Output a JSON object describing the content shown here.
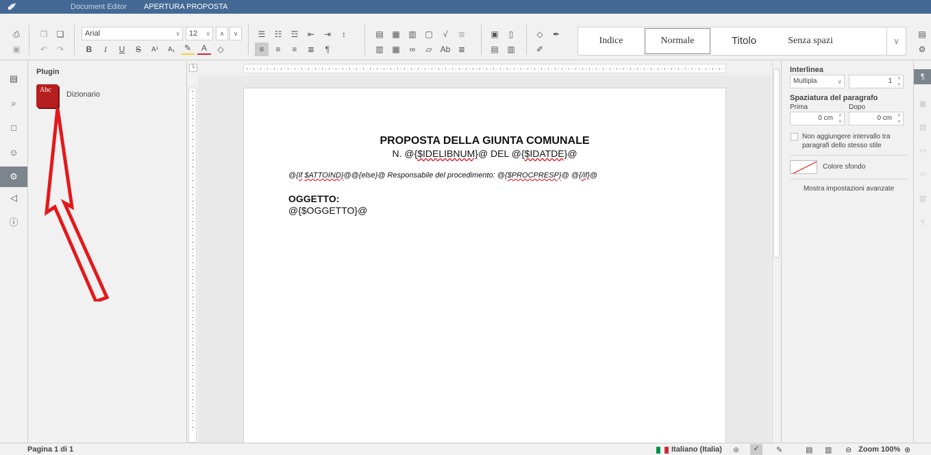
{
  "titlebar": {
    "app_name": "Document Editor",
    "document_name": "APERTURA PROPOSTA"
  },
  "toolbar": {
    "font_name": "Arial",
    "font_size": "12",
    "styles": [
      "Indice",
      "Normale",
      "Titolo",
      "Senza spazi"
    ],
    "selected_style": "Normale",
    "superscript_label": "A¹",
    "subscript_label": "A₁"
  },
  "plugin_panel": {
    "title": "Plugin",
    "plugins": [
      {
        "name": "Dizionario",
        "icon": "dictionary-book-icon",
        "icon_text": "Abc"
      }
    ]
  },
  "document": {
    "heading": "PROPOSTA DELLA GIUNTA COMUNALE",
    "subheading_prefix": "N. @{",
    "subheading_var1": "$IDELIBNUM}",
    "subheading_mid": "@ DEL @{",
    "subheading_var2": "$IDATDE}",
    "subheading_suffix": "@",
    "responsible_line": {
      "p1": "@{",
      "p2": "if",
      "p3": " ",
      "p4": "$ATTOIND}",
      "p5": "@@{else}@ Responsabile del procedimento: @{",
      "p6": "$PROCPRESP}",
      "p7": "@ @{",
      "p8": "/if}",
      "p9": "@"
    },
    "subject_label": "OGGETTO:",
    "subject_value": "@{$OGGETTO}@"
  },
  "right_panel": {
    "line_spacing_title": "Interlinea",
    "line_spacing_mode": "Multipla",
    "line_spacing_value": "1",
    "paragraph_spacing_title": "Spaziatura del paragrafo",
    "before_label": "Prima",
    "after_label": "Dopo",
    "before_value": "0 cm",
    "after_value": "0 cm",
    "no_interval_label_line1": "Non aggiungere intervallo tra",
    "no_interval_label_line2": "paragrafi dello stesso stile",
    "background_color_label": "Colore sfondo",
    "advanced_settings_label": "Mostra impostazioni avanzate"
  },
  "statusbar": {
    "page_info": "Pagina 1 di 1",
    "language": "Italiano (Italia)",
    "zoom": "Zoom 100%"
  },
  "colors": {
    "titlebar": "#446995",
    "annotation_arrow": "#e3191c",
    "plugin_icon": "#b61f1f",
    "active_sidebar": "#7d858c"
  }
}
